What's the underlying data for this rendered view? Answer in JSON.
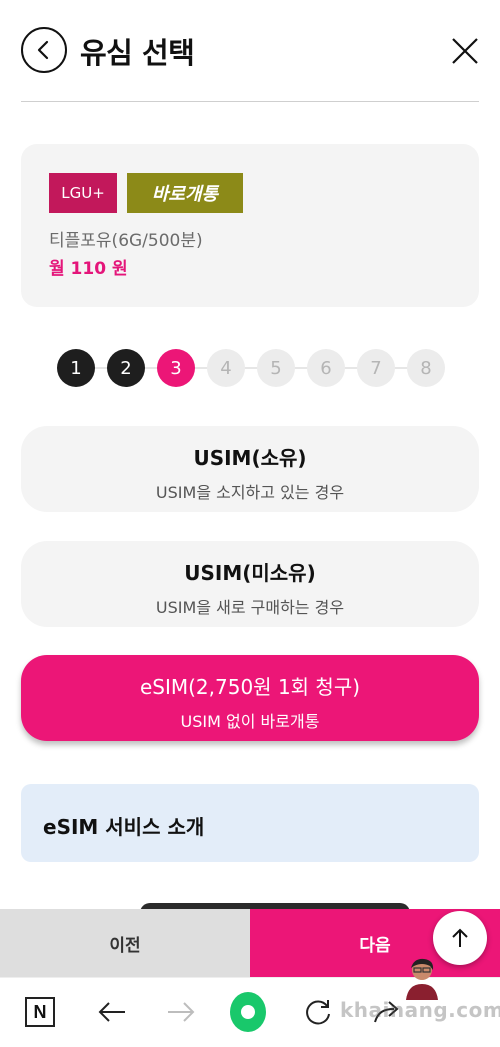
{
  "header": {
    "title": "유심 선택"
  },
  "plan": {
    "carrier_badge": "LGU+",
    "activation_badge": "바로개통",
    "name": "티플포유(6G/500분)",
    "price": "월 110 원"
  },
  "steps": {
    "items": [
      "1",
      "2",
      "3",
      "4",
      "5",
      "6",
      "7",
      "8"
    ],
    "current": 3
  },
  "options": [
    {
      "title": "USIM(소유)",
      "subtitle": "USIM을 소지하고 있는 경우"
    },
    {
      "title": "USIM(미소유)",
      "subtitle": "USIM을 새로 구매하는 경우"
    },
    {
      "title": "eSIM(2,750원 1회 청구)",
      "subtitle": "USIM 없이 바로개통"
    }
  ],
  "selected_option": 2,
  "intro": {
    "label": "eSIM 서비스 소개"
  },
  "footer": {
    "prev_label": "이전",
    "next_label": "다음"
  },
  "watermark": "khainang.com",
  "colors": {
    "accent": "#ec1677",
    "carrier_badge": "#c2185b",
    "activation_badge": "#8c8a18",
    "price": "#e4157a",
    "intro_bg": "#e3edf9",
    "browser_home": "#19c86b"
  },
  "icons": {
    "back": "chevron-left-icon",
    "close": "close-icon",
    "scroll_top": "arrow-up-icon",
    "browser": [
      "naver-n-icon",
      "arrow-left-icon",
      "arrow-right-icon",
      "home-dot-icon",
      "refresh-icon",
      "share-icon"
    ]
  }
}
